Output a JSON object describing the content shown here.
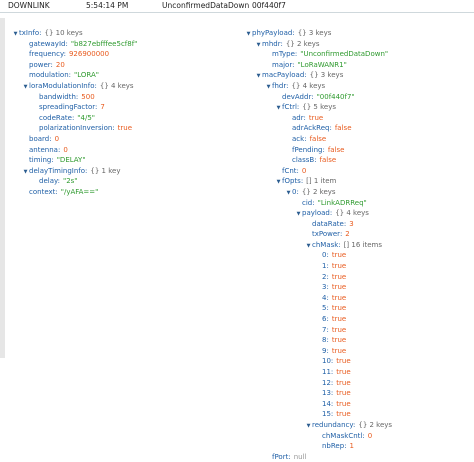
{
  "header": {
    "direction": "DOWNLINK",
    "time": "5:54:14 PM",
    "type": "UnconfirmedDataDown",
    "dev_addr": "00f440f7"
  },
  "left_tree": [
    {
      "depth": 0,
      "toggle": "down",
      "key": "txInfo",
      "meta": "{}  10 keys"
    },
    {
      "depth": 1,
      "key": "gatewayId",
      "value": "\"b827ebfffee5cf8f\"",
      "vtype": "s"
    },
    {
      "depth": 1,
      "key": "frequency",
      "value": "926900000",
      "vtype": "n"
    },
    {
      "depth": 1,
      "key": "power",
      "value": "20",
      "vtype": "n"
    },
    {
      "depth": 1,
      "key": "modulation",
      "value": "\"LORA\"",
      "vtype": "s"
    },
    {
      "depth": 1,
      "toggle": "down",
      "key": "loraModulationInfo",
      "meta": "{}  4 keys"
    },
    {
      "depth": 2,
      "key": "bandwidth",
      "value": "500",
      "vtype": "n"
    },
    {
      "depth": 2,
      "key": "spreadingFactor",
      "value": "7",
      "vtype": "n"
    },
    {
      "depth": 2,
      "key": "codeRate",
      "value": "\"4/5\"",
      "vtype": "s"
    },
    {
      "depth": 2,
      "key": "polarizationInversion",
      "value": "true",
      "vtype": "b"
    },
    {
      "depth": 1,
      "key": "board",
      "value": "0",
      "vtype": "n"
    },
    {
      "depth": 1,
      "key": "antenna",
      "value": "0",
      "vtype": "n"
    },
    {
      "depth": 1,
      "key": "timing",
      "value": "\"DELAY\"",
      "vtype": "s"
    },
    {
      "depth": 1,
      "toggle": "down",
      "key": "delayTimingInfo",
      "meta": "{}  1 key"
    },
    {
      "depth": 2,
      "key": "delay",
      "value": "\"2s\"",
      "vtype": "s"
    },
    {
      "depth": 1,
      "key": "context",
      "value": "\"/yAFA==\"",
      "vtype": "s"
    }
  ],
  "right_tree": [
    {
      "depth": 0,
      "toggle": "down",
      "key": "phyPayload",
      "meta": "{}  3 keys"
    },
    {
      "depth": 1,
      "toggle": "down",
      "key": "mhdr",
      "meta": "{}  2 keys"
    },
    {
      "depth": 2,
      "key": "mType",
      "value": "\"UnconfirmedDataDown\"",
      "vtype": "s"
    },
    {
      "depth": 2,
      "key": "major",
      "value": "\"LoRaWANR1\"",
      "vtype": "s"
    },
    {
      "depth": 1,
      "toggle": "down",
      "key": "macPayload",
      "meta": "{}  3 keys"
    },
    {
      "depth": 2,
      "toggle": "down",
      "key": "fhdr",
      "meta": "{}  4 keys"
    },
    {
      "depth": 3,
      "key": "devAddr",
      "value": "\"00f440f7\"",
      "vtype": "s"
    },
    {
      "depth": 3,
      "toggle": "down",
      "key": "fCtrl",
      "meta": "{}  5 keys"
    },
    {
      "depth": 4,
      "key": "adr",
      "value": "true",
      "vtype": "b"
    },
    {
      "depth": 4,
      "key": "adrAckReq",
      "value": "false",
      "vtype": "b"
    },
    {
      "depth": 4,
      "key": "ack",
      "value": "false",
      "vtype": "b"
    },
    {
      "depth": 4,
      "key": "fPending",
      "value": "false",
      "vtype": "b"
    },
    {
      "depth": 4,
      "key": "classB",
      "value": "false",
      "vtype": "b"
    },
    {
      "depth": 3,
      "key": "fCnt",
      "value": "0",
      "vtype": "n"
    },
    {
      "depth": 3,
      "toggle": "down",
      "key": "fOpts",
      "meta": "[]  1 item"
    },
    {
      "depth": 4,
      "toggle": "down",
      "key": "0",
      "meta": "{}  2 keys"
    },
    {
      "depth": 5,
      "key": "cid",
      "value": "\"LinkADRReq\"",
      "vtype": "s"
    },
    {
      "depth": 5,
      "toggle": "down",
      "key": "payload",
      "meta": "{}  4 keys"
    },
    {
      "depth": 6,
      "key": "dataRate",
      "value": "3",
      "vtype": "n"
    },
    {
      "depth": 6,
      "key": "txPower",
      "value": "2",
      "vtype": "n"
    },
    {
      "depth": 6,
      "toggle": "down",
      "key": "chMask",
      "meta": "[]  16 items"
    },
    {
      "depth": 7,
      "key": "0",
      "value": "true",
      "vtype": "b"
    },
    {
      "depth": 7,
      "key": "1",
      "value": "true",
      "vtype": "b"
    },
    {
      "depth": 7,
      "key": "2",
      "value": "true",
      "vtype": "b"
    },
    {
      "depth": 7,
      "key": "3",
      "value": "true",
      "vtype": "b"
    },
    {
      "depth": 7,
      "key": "4",
      "value": "true",
      "vtype": "b"
    },
    {
      "depth": 7,
      "key": "5",
      "value": "true",
      "vtype": "b"
    },
    {
      "depth": 7,
      "key": "6",
      "value": "true",
      "vtype": "b"
    },
    {
      "depth": 7,
      "key": "7",
      "value": "true",
      "vtype": "b"
    },
    {
      "depth": 7,
      "key": "8",
      "value": "true",
      "vtype": "b"
    },
    {
      "depth": 7,
      "key": "9",
      "value": "true",
      "vtype": "b"
    },
    {
      "depth": 7,
      "key": "10",
      "value": "true",
      "vtype": "b"
    },
    {
      "depth": 7,
      "key": "11",
      "value": "true",
      "vtype": "b"
    },
    {
      "depth": 7,
      "key": "12",
      "value": "true",
      "vtype": "b"
    },
    {
      "depth": 7,
      "key": "13",
      "value": "true",
      "vtype": "b"
    },
    {
      "depth": 7,
      "key": "14",
      "value": "true",
      "vtype": "b"
    },
    {
      "depth": 7,
      "key": "15",
      "value": "true",
      "vtype": "b"
    },
    {
      "depth": 6,
      "toggle": "down",
      "key": "redundancy",
      "meta": "{}  2 keys"
    },
    {
      "depth": 7,
      "key": "chMaskCntl",
      "value": "0",
      "vtype": "n"
    },
    {
      "depth": 7,
      "key": "nbRep",
      "value": "1",
      "vtype": "n"
    },
    {
      "depth": 2,
      "key": "fPort",
      "value": "null",
      "vtype": "nul"
    }
  ],
  "colors": {
    "key": "#1f5fa6",
    "string": "#2e9a2e",
    "number": "#e85a1d",
    "boolean": "#e85a1d",
    "meta": "#666666"
  }
}
